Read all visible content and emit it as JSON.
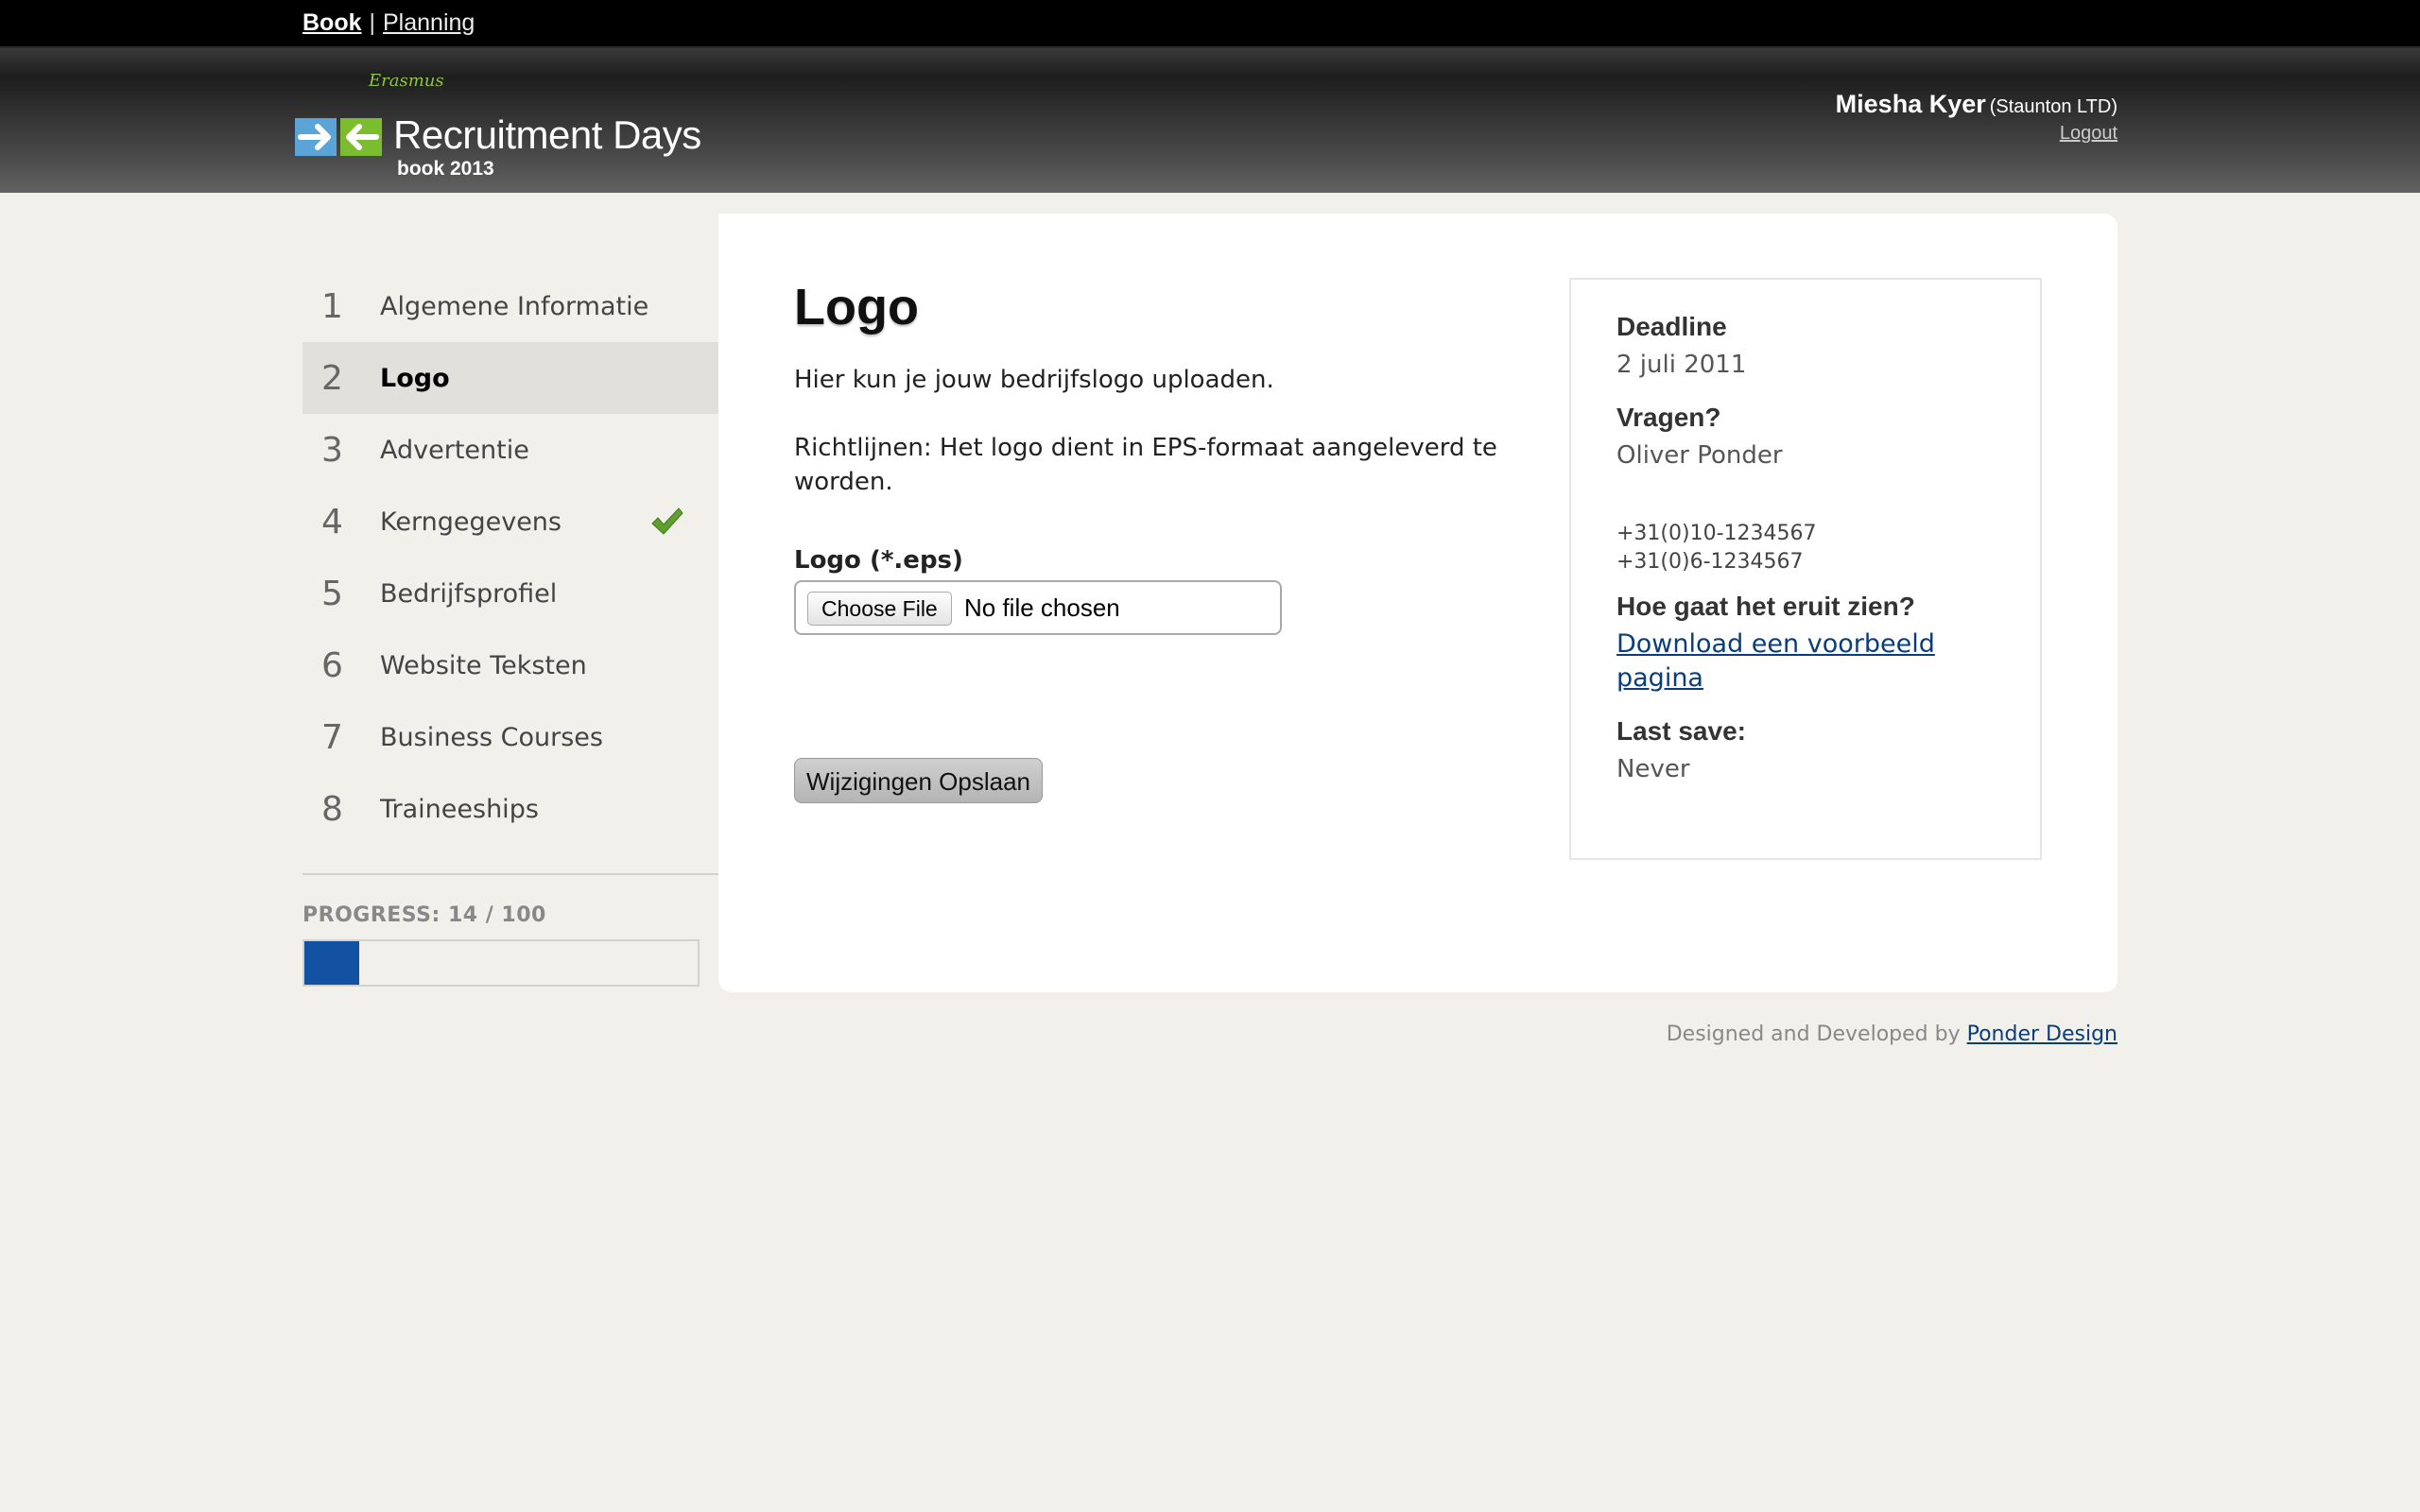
{
  "topnav": {
    "book": "Book",
    "separator": "|",
    "planning": "Planning"
  },
  "header": {
    "logo": {
      "script": "Erasmus",
      "title": "Recruitment Days",
      "subtitle": "book 2013"
    },
    "user": {
      "name": "Miesha Kyer",
      "company": "(Staunton LTD)",
      "logout": "Logout"
    }
  },
  "sidebar": {
    "steps": [
      {
        "num": "1",
        "label": "Algemene Informatie",
        "active": false,
        "done": false
      },
      {
        "num": "2",
        "label": "Logo",
        "active": true,
        "done": false
      },
      {
        "num": "3",
        "label": "Advertentie",
        "active": false,
        "done": false
      },
      {
        "num": "4",
        "label": "Kerngegevens",
        "active": false,
        "done": true
      },
      {
        "num": "5",
        "label": "Bedrijfsprofiel",
        "active": false,
        "done": false
      },
      {
        "num": "6",
        "label": "Website Teksten",
        "active": false,
        "done": false
      },
      {
        "num": "7",
        "label": "Business Courses",
        "active": false,
        "done": false
      },
      {
        "num": "8",
        "label": "Traineeships",
        "active": false,
        "done": false
      }
    ],
    "progress": {
      "label": "PROGRESS: 14 / 100",
      "value": 14,
      "max": 100,
      "color": "#1352a2"
    }
  },
  "main": {
    "title": "Logo",
    "intro": "Hier kun je jouw bedrijfslogo uploaden.",
    "guidelines": "Richtlijnen: Het logo dient in EPS-formaat aangeleverd te worden.",
    "field_label": "Logo (*.eps)",
    "choose_file": "Choose File",
    "file_status": "No file chosen",
    "save_button": "Wijzigingen Opslaan"
  },
  "info": {
    "deadline_heading": "Deadline",
    "deadline_value": "2 juli 2011",
    "questions_heading": "Vragen?",
    "contact_name": "Oliver Ponder",
    "phone_1": "+31(0)10-1234567",
    "phone_2": "+31(0)6-1234567",
    "preview_heading": "Hoe gaat het eruit zien?",
    "download_link": "Download een voorbeeld pagina",
    "last_save_heading": "Last save:",
    "last_save_value": "Never"
  },
  "footer": {
    "text": "Designed and Developed by",
    "link": "Ponder Design"
  }
}
